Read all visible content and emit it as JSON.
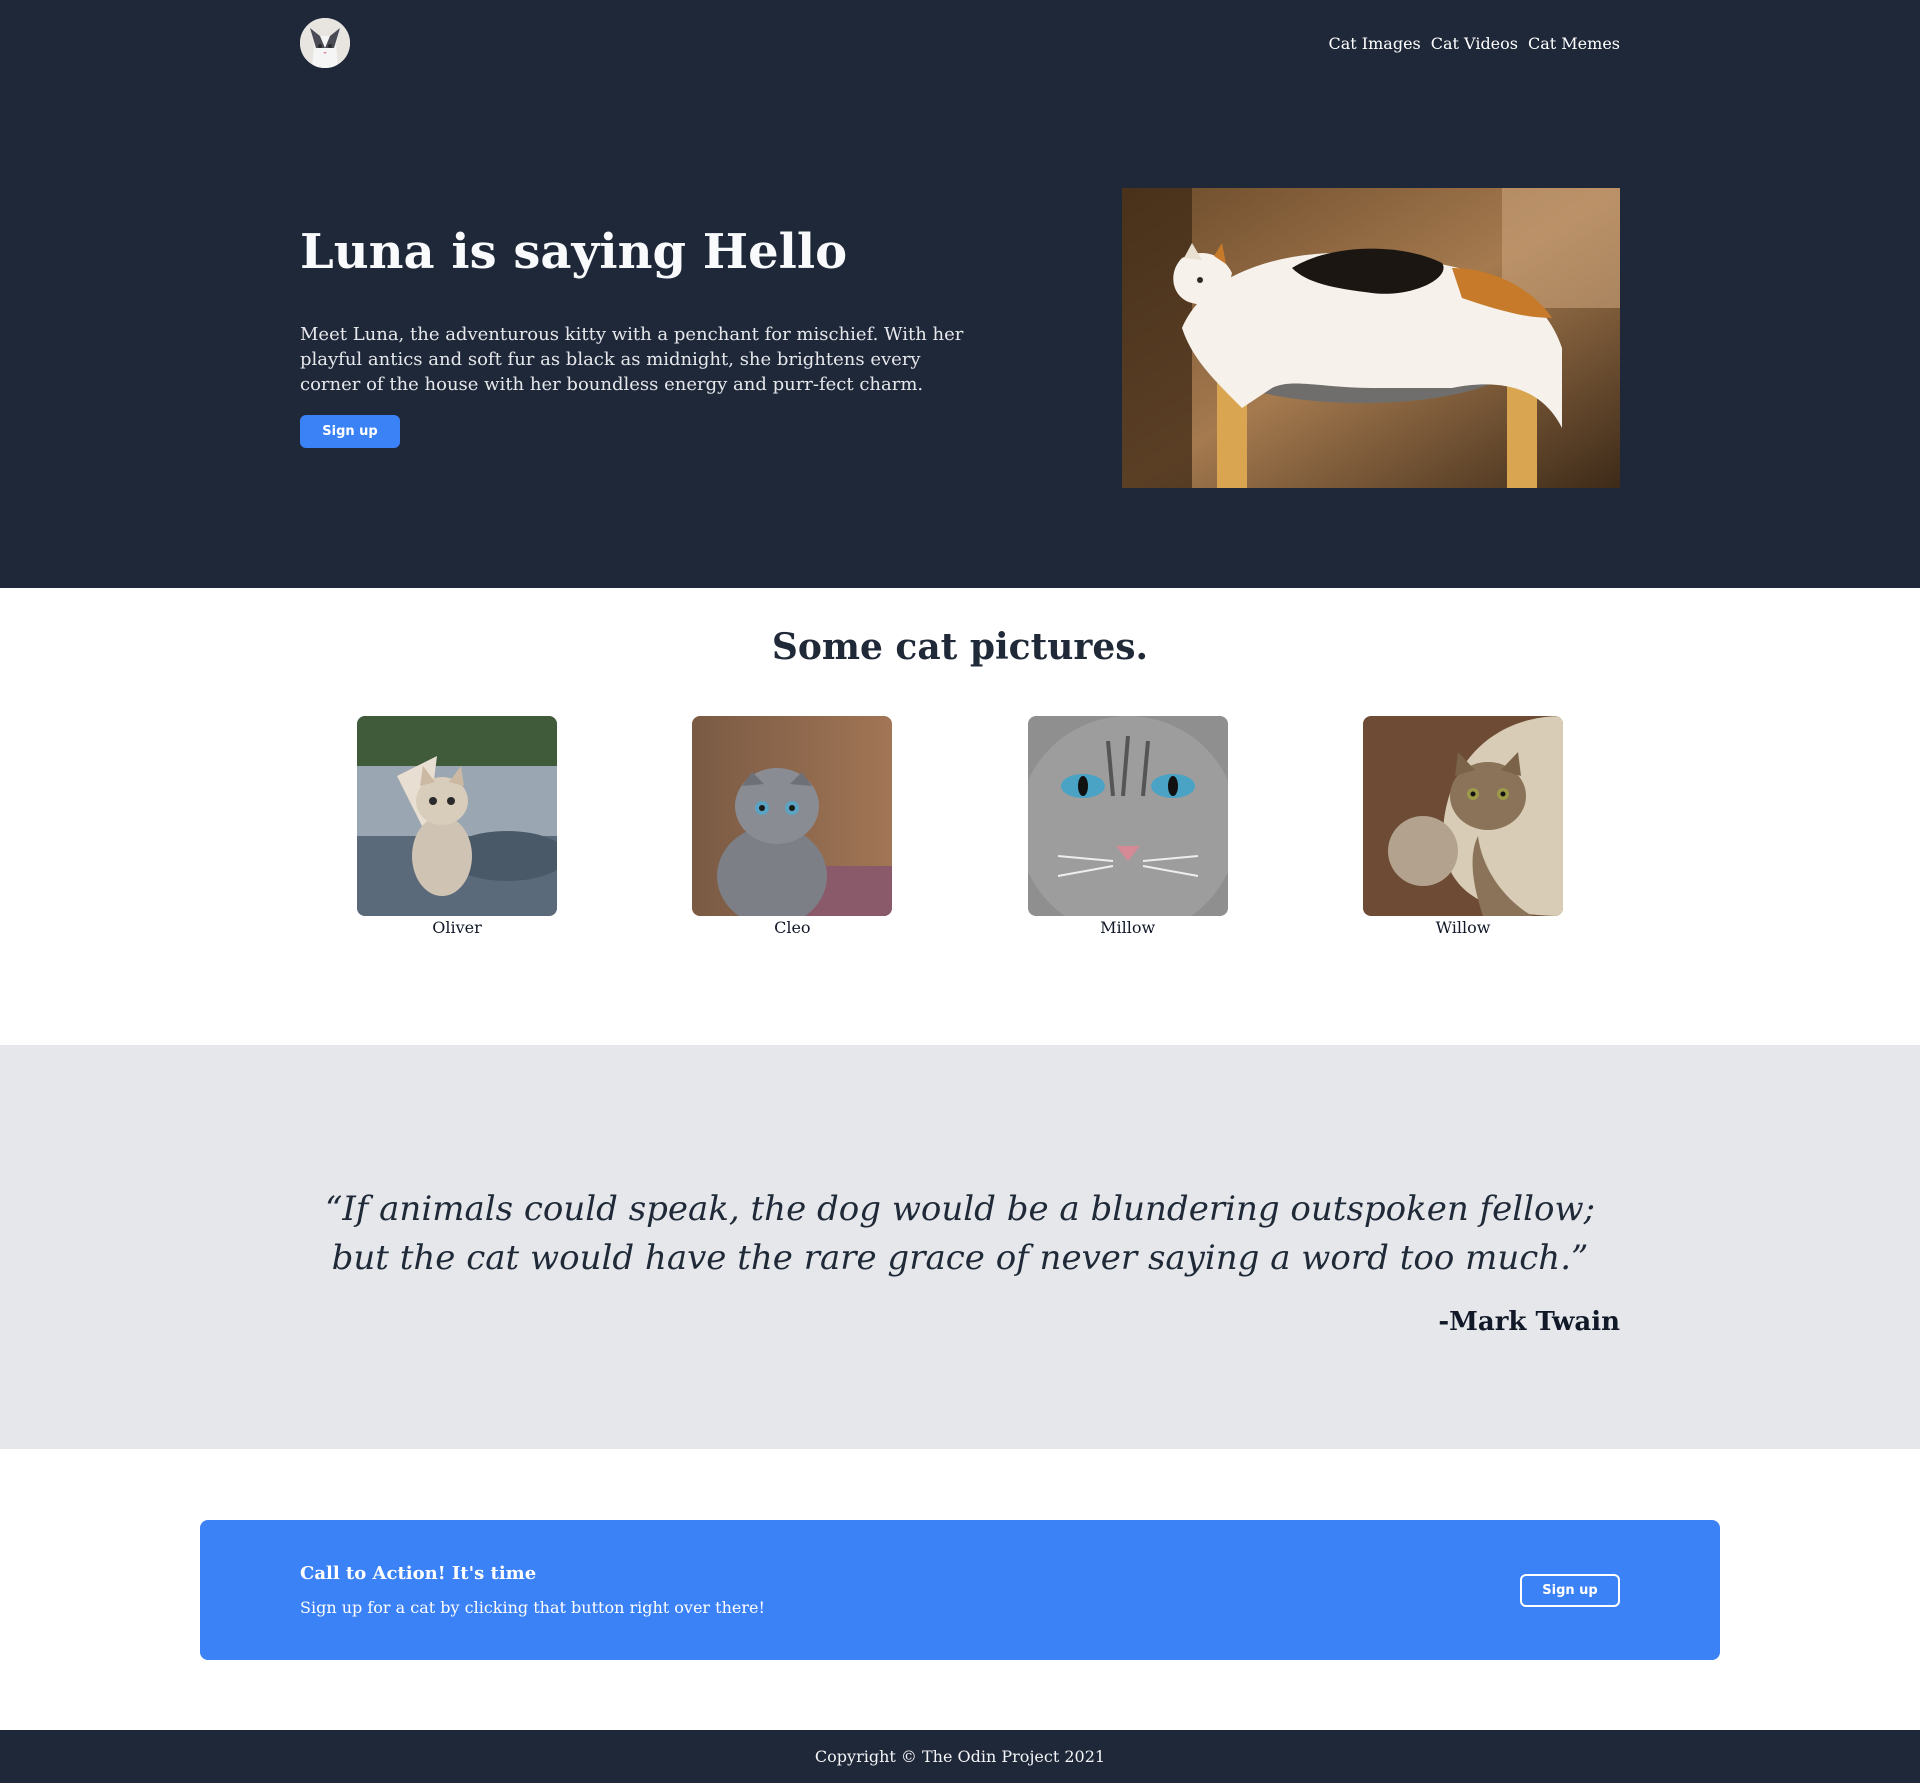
{
  "header": {
    "logo_icon": "cat-avatar-icon",
    "nav": [
      {
        "label": "Cat Images"
      },
      {
        "label": "Cat Videos"
      },
      {
        "label": "Cat Memes"
      }
    ]
  },
  "hero": {
    "title": "Luna is saying Hello",
    "description": "Meet Luna, the adventurous kitty with a penchant for mischief. With her playful antics and soft fur as black as midnight, she brightens every corner of the house with her boundless energy and purr-fect charm.",
    "button_label": "Sign up"
  },
  "pictures": {
    "title": "Some cat pictures.",
    "cats": [
      {
        "name": "Oliver"
      },
      {
        "name": "Cleo"
      },
      {
        "name": "Millow"
      },
      {
        "name": "Willow"
      }
    ]
  },
  "quote": {
    "text": "“If animals could speak, the dog would be a blundering outspoken fellow; but the cat would have the rare grace of never saying a word too much.”",
    "author": "-Mark Twain"
  },
  "cta": {
    "title": "Call to Action! It's time",
    "subtitle": "Sign up for a cat by clicking that button right over there!",
    "button_label": "Sign up"
  },
  "footer": {
    "copyright": "Copyright © The Odin Project 2021"
  },
  "colors": {
    "dark": "#1f2839",
    "accent": "#3b82f6",
    "quote_bg": "#e5e7eb"
  }
}
